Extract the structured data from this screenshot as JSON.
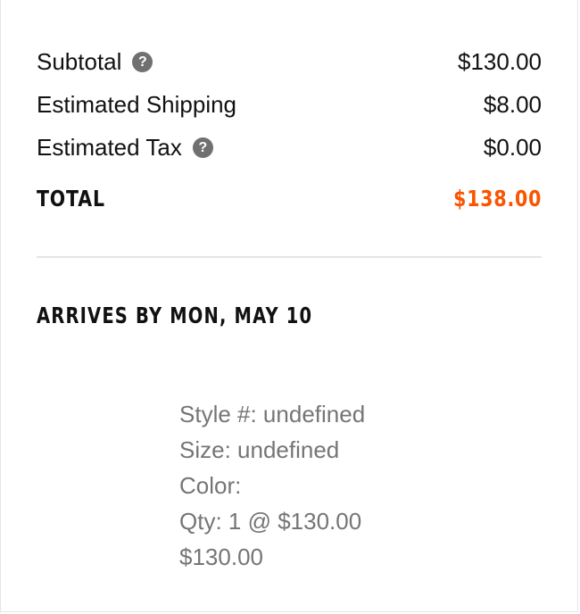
{
  "summary": {
    "subtotal_label": "Subtotal",
    "subtotal_value": "$130.00",
    "shipping_label": "Estimated Shipping",
    "shipping_value": "$8.00",
    "tax_label": "Estimated Tax",
    "tax_value": "$0.00",
    "total_label": "TOTAL",
    "total_value": "$138.00",
    "help_icon_glyph": "?"
  },
  "delivery": {
    "arrives_text": "ARRIVES BY MON, MAY 10"
  },
  "item": {
    "style": "Style #: undefined",
    "size": "Size: undefined",
    "color": "Color:",
    "qty": "Qty: 1 @ $130.00",
    "price": "$130.00"
  },
  "colors": {
    "accent_total": "#fa5400",
    "help_icon": "#707070",
    "detail_text": "#757575",
    "divider": "#e5e5e5"
  }
}
